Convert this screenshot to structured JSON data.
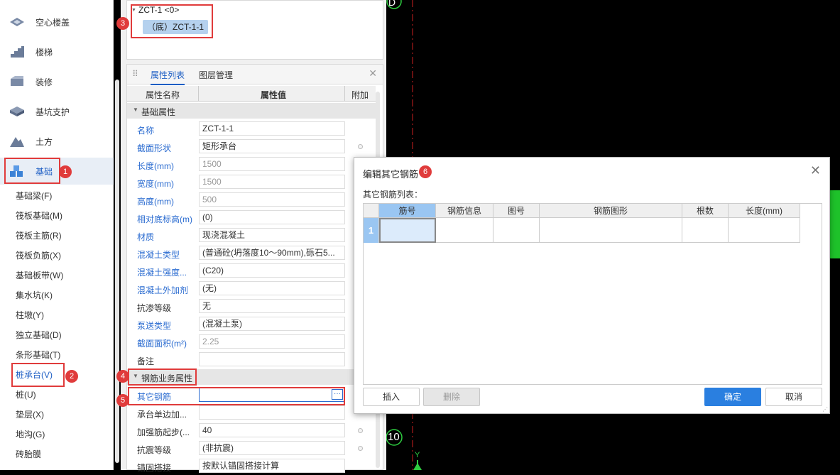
{
  "sidebar": {
    "categories": [
      {
        "label": "空心楼盖",
        "icon": "hollow-floor-icon"
      },
      {
        "label": "楼梯",
        "icon": "stairs-icon"
      },
      {
        "label": "装修",
        "icon": "decoration-icon"
      },
      {
        "label": "基坑支护",
        "icon": "pit-support-icon"
      },
      {
        "label": "土方",
        "icon": "earthwork-icon"
      },
      {
        "label": "基础",
        "icon": "foundation-icon"
      }
    ],
    "sub_items": [
      "基础梁(F)",
      "筏板基础(M)",
      "筏板主筋(R)",
      "筏板负筋(X)",
      "基础板带(W)",
      "集水坑(K)",
      "柱墩(Y)",
      "独立基础(D)",
      "条形基础(T)",
      "桩承台(V)",
      "桩(U)",
      "垫层(X)",
      "地沟(G)",
      "砖胎膜"
    ]
  },
  "tree": {
    "root": "ZCT-1 <0>",
    "child": "（底）ZCT-1-1"
  },
  "props": {
    "tabs": [
      "属性列表",
      "图层管理"
    ],
    "headers": [
      "属性名称",
      "属性值",
      "附加"
    ],
    "group1": "基础属性",
    "rows": [
      {
        "name": "名称",
        "value": "ZCT-1-1"
      },
      {
        "name": "截面形状",
        "value": "矩形承台"
      },
      {
        "name": "长度(mm)",
        "value": "1500"
      },
      {
        "name": "宽度(mm)",
        "value": "1500"
      },
      {
        "name": "高度(mm)",
        "value": "500"
      },
      {
        "name": "相对底标高(m)",
        "value": "(0)"
      },
      {
        "name": "材质",
        "value": "现浇混凝土"
      },
      {
        "name": "混凝土类型",
        "value": "(普通砼(坍落度10～90mm),砾石5..."
      },
      {
        "name": "混凝土强度...",
        "value": "(C20)"
      },
      {
        "name": "混凝土外加剂",
        "value": "(无)"
      },
      {
        "name": "抗渗等级",
        "value": "无"
      },
      {
        "name": "泵送类型",
        "value": "(混凝土泵)"
      },
      {
        "name": "截面面积(m²)",
        "value": "2.25"
      },
      {
        "name": "备注",
        "value": ""
      }
    ],
    "group2": "钢筋业务属性",
    "rows2": [
      {
        "name": "其它钢筋",
        "value": ""
      },
      {
        "name": "承台单边加...",
        "value": ""
      },
      {
        "name": "加强筋起步(...",
        "value": "40"
      },
      {
        "name": "抗震等级",
        "value": "(非抗震)"
      },
      {
        "name": "锚固搭接",
        "value": "按默认锚固搭接计算"
      }
    ],
    "ellipsis": "···"
  },
  "canvas": {
    "label_top": "D",
    "label_bottom": "10",
    "axis_y": "Y"
  },
  "dialog": {
    "title": "编辑其它钢筋",
    "subtitle": "其它钢筋列表：",
    "columns": [
      "筋号",
      "钢筋信息",
      "图号",
      "钢筋图形",
      "根数",
      "长度(mm)"
    ],
    "row_number": "1",
    "buttons": {
      "insert": "插入",
      "delete": "删除",
      "ok": "确定",
      "cancel": "取消"
    },
    "close": "✕"
  },
  "callouts": [
    "1",
    "2",
    "3",
    "4",
    "5",
    "6"
  ],
  "colors": {
    "accent": "#1d5ec4",
    "callout": "#e03b3b",
    "primary_button": "#2a7fe0"
  }
}
